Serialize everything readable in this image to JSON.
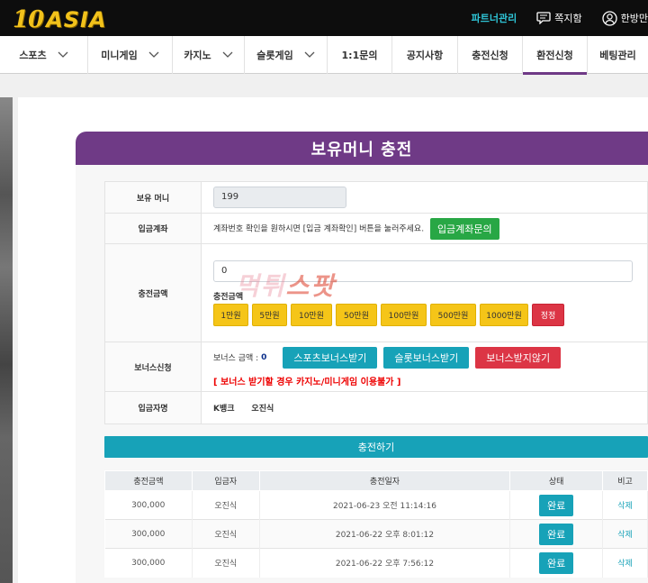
{
  "brand": {
    "num": "10",
    "word": "ASIA",
    "gold": "#f2c21b"
  },
  "top_links": {
    "partner": "파트너관리",
    "messages": "쪽지함",
    "user": "한방만"
  },
  "nav": [
    {
      "label": "스포츠",
      "has_dropdown": true
    },
    {
      "label": "미니게임",
      "has_dropdown": true
    },
    {
      "label": "카지노",
      "has_dropdown": true
    },
    {
      "label": "슬롯게임",
      "has_dropdown": true
    },
    {
      "label": "1:1문의",
      "has_dropdown": false
    },
    {
      "label": "공지사항",
      "has_dropdown": false
    },
    {
      "label": "충전신청",
      "has_dropdown": false
    },
    {
      "label": "환전신청",
      "has_dropdown": false,
      "active": true
    },
    {
      "label": "베팅관리",
      "has_dropdown": false
    }
  ],
  "page_title": "보유머니 충전",
  "form": {
    "balance_label": "보유 머니",
    "balance_value": "199",
    "account_label": "입금계좌",
    "account_help": "계좌번호 확인을 원하시면 [입금 계좌확인] 버튼을 눌러주세요.",
    "account_button": "입금계좌문의",
    "amount_label": "충전금액",
    "amount_value": "0",
    "amount_sub_label": "충전금액",
    "chips": [
      "1만원",
      "5만원",
      "10만원",
      "50만원",
      "100만원",
      "500만원",
      "1000만원"
    ],
    "reset_label": "정정",
    "bonus_label": "보너스신청",
    "bonus_amount_label": "보너스 금액 :",
    "bonus_amount_value": "0",
    "bonus_sports": "스포츠보너스받기",
    "bonus_slot": "슬롯보너스받기",
    "bonus_none": "보너스받지않기",
    "bonus_warning": "[ 보너스 받기할 경우 카지노/미니게임 이용불가 ]",
    "depositor_label": "입금자명",
    "depositor_bank": "K뱅크",
    "depositor_name": "오진식",
    "submit_label": "충전하기"
  },
  "history": {
    "headers": [
      "충전금액",
      "입금자",
      "충전일자",
      "상태",
      "비고"
    ],
    "rows": [
      {
        "amount": "300,000",
        "name": "오진식",
        "date": "2021-06-23 오전 11:14:16",
        "status": "완료",
        "note": "삭제"
      },
      {
        "amount": "300,000",
        "name": "오진식",
        "date": "2021-06-22 오후 8:01:12",
        "status": "완료",
        "note": "삭제"
      },
      {
        "amount": "300,000",
        "name": "오진식",
        "date": "2021-06-22 오후 7:56:12",
        "status": "완료",
        "note": "삭제"
      }
    ]
  },
  "watermark": {
    "part1": "먹튀",
    "part2": "스팟"
  },
  "colors": {
    "purple": "#6f3a86",
    "teal": "#17a2b8",
    "green": "#28a745",
    "red": "#dc3545",
    "yellow": "#f5c518"
  }
}
